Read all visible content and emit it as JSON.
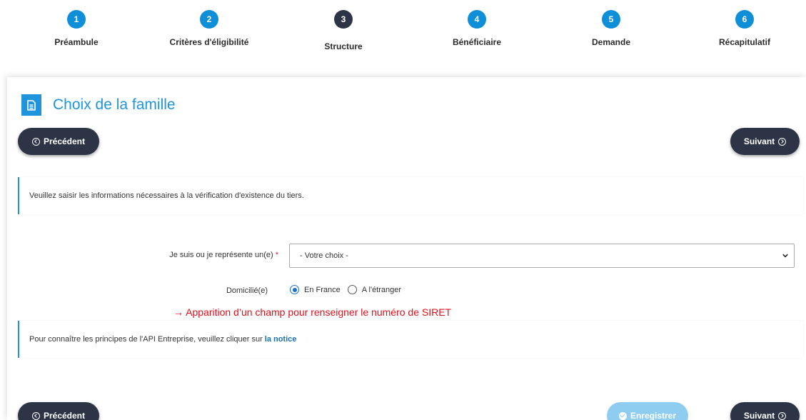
{
  "stepper": {
    "steps": [
      {
        "number": "1",
        "label": "Préambule"
      },
      {
        "number": "2",
        "label": "Critères d'éligibilité"
      },
      {
        "number": "3",
        "label": "Structure"
      },
      {
        "number": "4",
        "label": "Bénéficiaire"
      },
      {
        "number": "5",
        "label": "Demande"
      },
      {
        "number": "6",
        "label": "Récapitulatif"
      }
    ],
    "active_step": "3"
  },
  "page": {
    "title": "Choix de la famille",
    "title_icon": "document-icon"
  },
  "nav": {
    "previous_label": "Précédent",
    "next_label": "Suivant",
    "save_label": "Enregistrer"
  },
  "info": {
    "verification_text": "Veuillez saisir les informations nécessaires à la vérification d'existence du tiers.",
    "api_text": "Pour connaître les principes de l'API Entreprise, veuillez cliquer sur",
    "api_link": "la notice"
  },
  "form": {
    "represent_label": "Je suis ou je représente un(e)",
    "required_mark": "*",
    "represent_value": "- Votre choix -",
    "domicile_label": "Domicilié(e)",
    "domicile_options": [
      "En France",
      "A l'étranger"
    ],
    "domicile_selected": "En France"
  },
  "annotation": {
    "text": "→ Apparition d’un champ pour renseigner le numéro de SIRET"
  },
  "colors": {
    "primary": "#1d94dc",
    "dark_button": "#2d3446",
    "save_disabled": "#8fcdf0",
    "annotation_red": "#e0101a"
  }
}
